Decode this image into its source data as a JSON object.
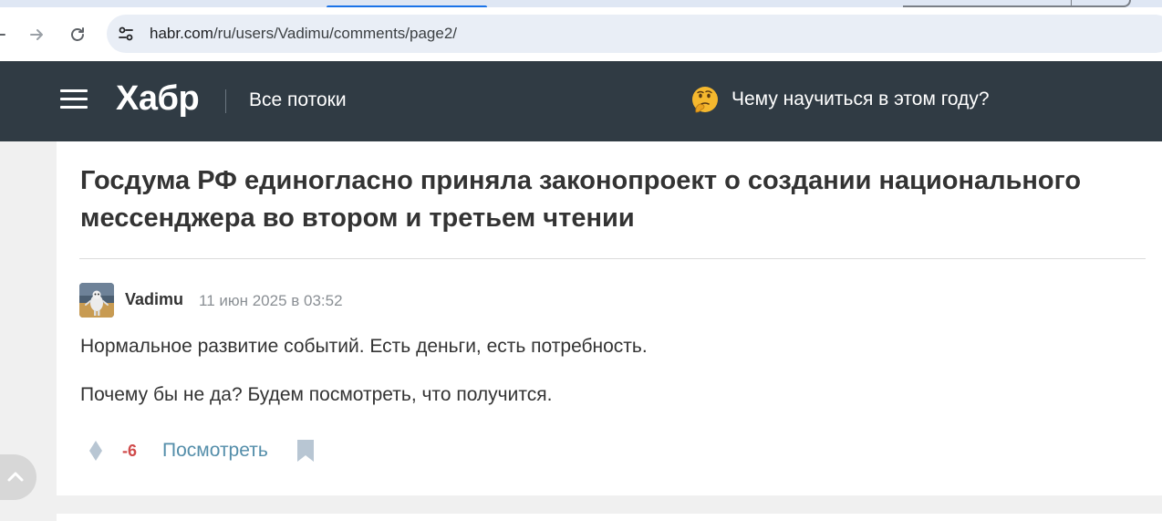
{
  "browser": {
    "url_host": "habr.com",
    "url_path": "/ru/users/Vadimu/comments/page2/"
  },
  "header": {
    "logo": "Хабр",
    "flows_label": "Все потоки",
    "promo_text": "Чему научиться в этом году?",
    "bg_color": "#303b44"
  },
  "article": {
    "title": "Госдума РФ единогласно приняла законопроект о создании национального мессенджера во втором и третьем чтении"
  },
  "comment": {
    "author": "Vadimu",
    "timestamp": "11 июн 2025 в 03:52",
    "paragraphs": [
      "Нормальное развитие событий. Есть деньги, есть потребность.",
      "Почему бы не да? Будем посмотреть, что получится."
    ],
    "score": "-6",
    "view_label": "Посмотреть",
    "score_color": "#d04b4b",
    "link_color": "#548eaa"
  }
}
